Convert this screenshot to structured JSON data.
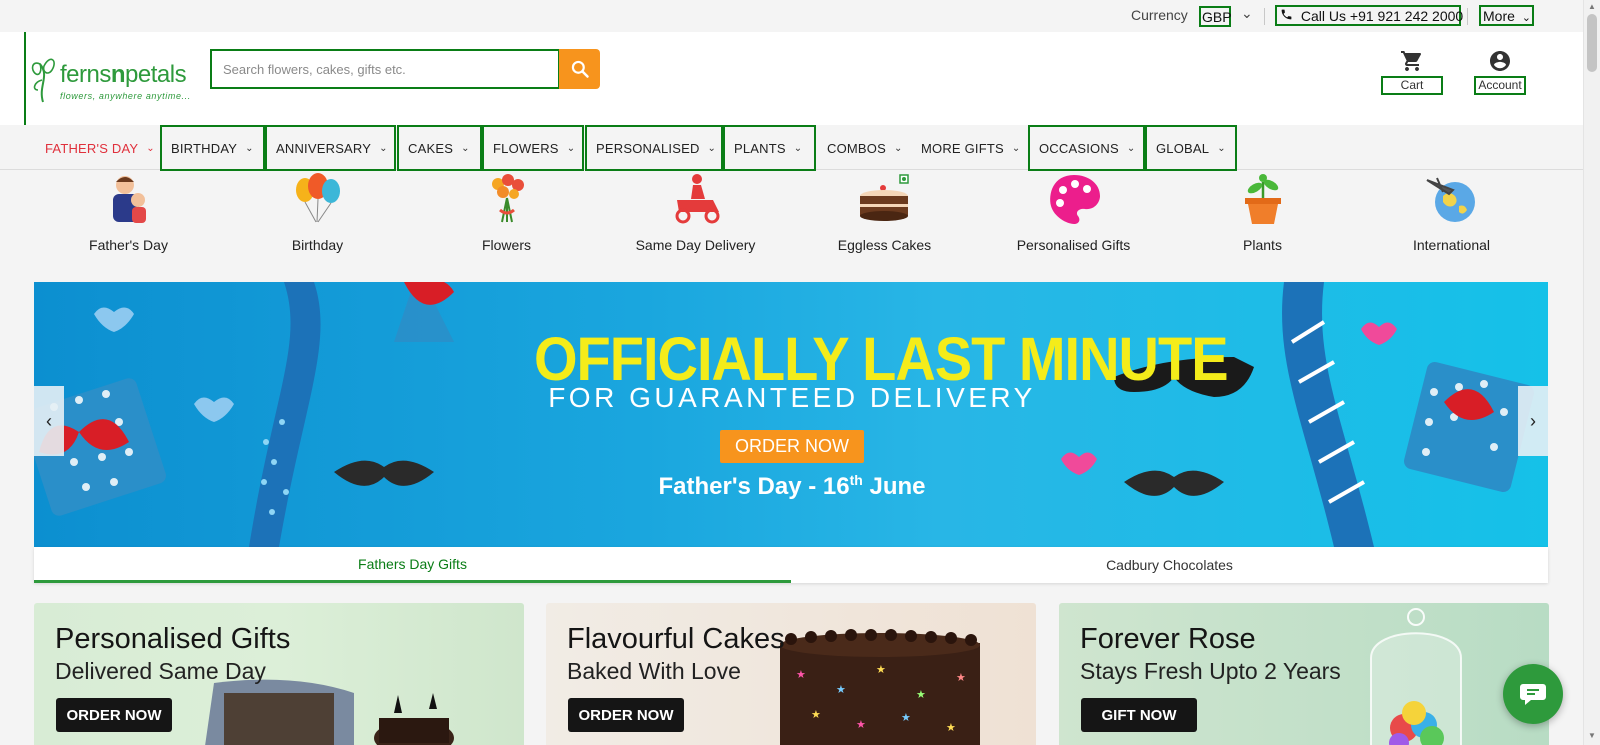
{
  "topbar": {
    "currency_label": "Currency",
    "currency_value": "GBP",
    "call_label": "Call Us +91 921 242 2000",
    "more_label": "More"
  },
  "header": {
    "brand_prefix": "ferns",
    "brand_mid": "n",
    "brand_suffix": "petals",
    "tagline": "flowers, anywhere anytime...",
    "search_placeholder": "Search flowers, cakes, gifts etc.",
    "cart_label": "Cart",
    "account_label": "Account"
  },
  "nav": {
    "items": [
      {
        "label": "FATHER'S DAY"
      },
      {
        "label": "BIRTHDAY"
      },
      {
        "label": "ANNIVERSARY"
      },
      {
        "label": "CAKES"
      },
      {
        "label": "FLOWERS"
      },
      {
        "label": "PERSONALISED"
      },
      {
        "label": "PLANTS"
      },
      {
        "label": "COMBOS"
      },
      {
        "label": "MORE GIFTS"
      },
      {
        "label": "OCCASIONS"
      },
      {
        "label": "GLOBAL"
      }
    ]
  },
  "categories": [
    {
      "label": "Father's Day",
      "icon": "fathers-day-icon"
    },
    {
      "label": "Birthday",
      "icon": "balloons-icon"
    },
    {
      "label": "Flowers",
      "icon": "bouquet-icon"
    },
    {
      "label": "Same Day Delivery",
      "icon": "delivery-scooter-icon"
    },
    {
      "label": "Eggless Cakes",
      "icon": "cake-icon"
    },
    {
      "label": "Personalised Gifts",
      "icon": "palette-icon"
    },
    {
      "label": "Plants",
      "icon": "potted-plant-icon"
    },
    {
      "label": "International",
      "icon": "globe-plane-icon"
    }
  ],
  "banner": {
    "headline": "OFFICIALLY LAST MINUTE",
    "subheadline": "FOR GUARANTEED DELIVERY",
    "cta": "ORDER NOW",
    "date_prefix": "Father's Day - 16",
    "date_sup": "th",
    "date_suffix": " June",
    "tabs": [
      {
        "label": "Fathers Day Gifts",
        "active": true
      },
      {
        "label": "Cadbury Chocolates",
        "active": false
      }
    ]
  },
  "promos": [
    {
      "title": "Personalised Gifts",
      "subtitle": "Delivered Same Day",
      "button": "ORDER NOW"
    },
    {
      "title": "Flavourful Cakes",
      "subtitle": "Baked With Love",
      "button": "ORDER NOW"
    },
    {
      "title": "Forever Rose",
      "subtitle": "Stays Fresh Upto 2 Years",
      "button": "GIFT NOW"
    }
  ],
  "colors": {
    "brand_green": "#2e9a3c",
    "accent_orange": "#f7941d",
    "active_red": "#e0303c",
    "highlight_border": "#0a7d16"
  }
}
